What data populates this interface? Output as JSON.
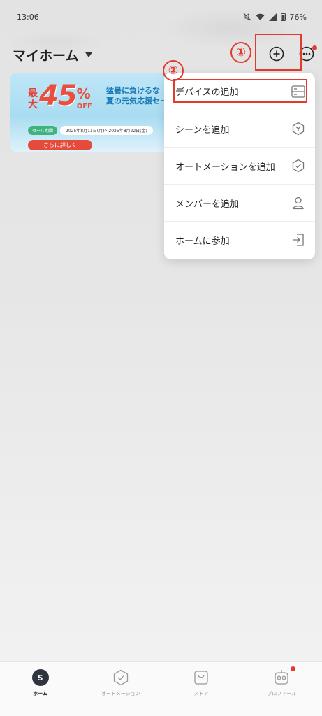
{
  "status_bar": {
    "time": "13:06",
    "battery": "76%"
  },
  "header": {
    "home_title": "マイホーム"
  },
  "annotations": {
    "one": "①",
    "two": "②"
  },
  "banner": {
    "pct_prefix": "最大",
    "pct_value": "45",
    "pct_sign": "%",
    "pct_off": "OFF",
    "headline_line1": "猛暑に負けるな",
    "headline_line2": "夏の元気応援セー",
    "period_tag": "セール期間",
    "period_dates": "2025年8月11日(月)〜2025年8月22日(金)",
    "more_label": "さらに詳しく"
  },
  "menu": {
    "items": [
      {
        "label": "デバイスの追加",
        "icon": "device-icon"
      },
      {
        "label": "シーンを追加",
        "icon": "scene-icon"
      },
      {
        "label": "オートメーションを追加",
        "icon": "automation-check-icon"
      },
      {
        "label": "メンバーを追加",
        "icon": "person-icon"
      },
      {
        "label": "ホームに参加",
        "icon": "join-icon"
      }
    ]
  },
  "bottom_nav": {
    "home_glyph": "S",
    "items": [
      {
        "label": "ホーム",
        "active": true
      },
      {
        "label": "オートメーション",
        "active": false
      },
      {
        "label": "ストア",
        "active": false
      },
      {
        "label": "プロフィール",
        "active": false
      }
    ]
  },
  "colors": {
    "accent_red": "#e23a2d",
    "badge_red": "#e53935",
    "nav_active": "#2e3440"
  }
}
